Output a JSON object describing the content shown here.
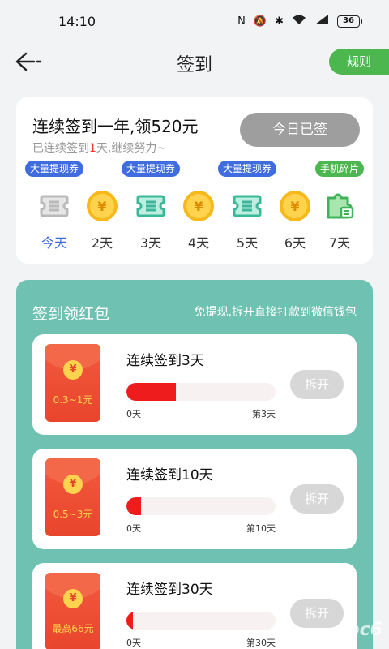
{
  "status_bar": {
    "time": "14:10",
    "battery": "36"
  },
  "nav": {
    "title": "签到",
    "rules_label": "规则"
  },
  "checkin": {
    "title": "连续签到一年,领520元",
    "sub_prefix": "已连续签到",
    "sub_count": "1",
    "sub_suffix": "天,继续努力~",
    "signed_label": "今日已签",
    "days": [
      {
        "label": "今天",
        "icon": "ticket-icon",
        "tag": "大量提现券"
      },
      {
        "label": "2天",
        "icon": "coin-icon",
        "tag": ""
      },
      {
        "label": "3天",
        "icon": "ticket-icon",
        "tag": "大量提现券"
      },
      {
        "label": "4天",
        "icon": "coin-icon",
        "tag": ""
      },
      {
        "label": "5天",
        "icon": "ticket-icon",
        "tag": "大量提现券"
      },
      {
        "label": "6天",
        "icon": "coin-icon",
        "tag": ""
      },
      {
        "label": "7天",
        "icon": "puzzle-icon",
        "tag": "手机碎片"
      }
    ],
    "coin_symbol": "¥"
  },
  "section": {
    "title": "签到领红包",
    "subtitle": "免提现,拆开直接打款到微信钱包",
    "items": [
      {
        "title": "连续签到3天",
        "amount": "0.3~1元",
        "progress": 0.33,
        "min": "0天",
        "max": "第3天",
        "button": "拆开"
      },
      {
        "title": "连续签到10天",
        "amount": "0.5~3元",
        "progress": 0.1,
        "min": "0天",
        "max": "第10天",
        "button": "拆开"
      },
      {
        "title": "连续签到30天",
        "amount": "最高66元",
        "progress": 0.033,
        "min": "0天",
        "max": "第30天",
        "button": "拆开"
      }
    ]
  },
  "watermark": "pc6",
  "colors": {
    "accent_blue": "#3f6de0",
    "green": "#4cb74e",
    "teal": "#6fc2b2",
    "red": "#ee1c1c"
  }
}
